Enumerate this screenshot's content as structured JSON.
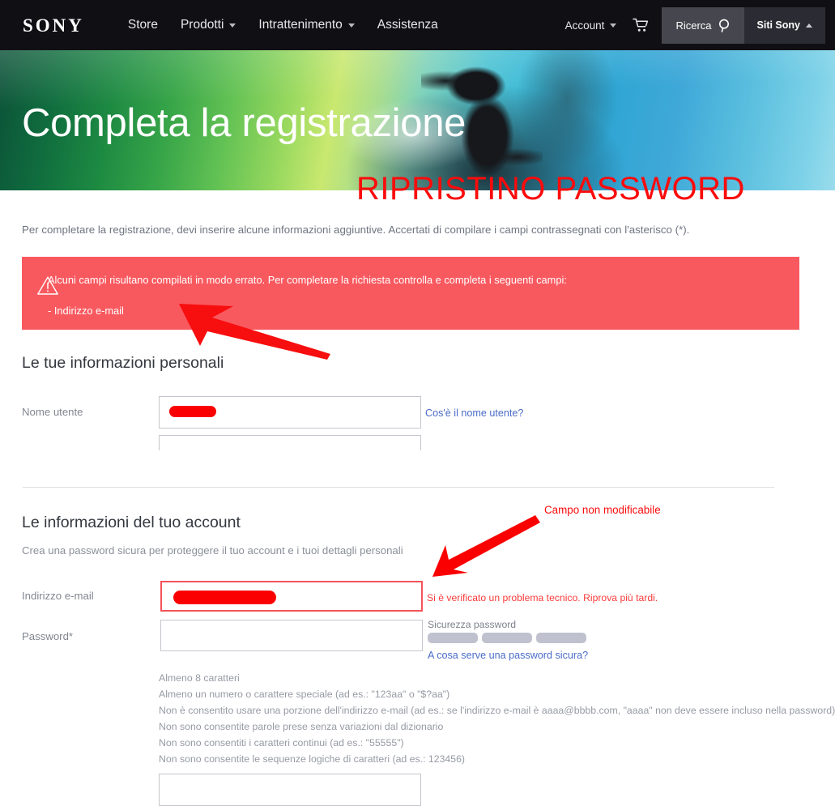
{
  "nav": {
    "logo": "SONY",
    "links": [
      {
        "label": "Store",
        "caret": null
      },
      {
        "label": "Prodotti",
        "caret": "chevron-down"
      },
      {
        "label": "Intrattenimento",
        "caret": "chevron-down"
      },
      {
        "label": "Assistenza",
        "caret": null
      }
    ],
    "account_label": "Account",
    "cart_icon": "shopping-cart-icon",
    "search_button": "Ricerca",
    "search_icon": "search-icon",
    "sites_button": "Siti Sony",
    "sites_caret": "chevron-up"
  },
  "hero": {
    "title": "Completa la registrazione"
  },
  "annotations": {
    "headline": "RIPRISTINO PASSWORD",
    "field_note": "Campo non modificabile"
  },
  "page": {
    "intro": "Per completare la registrazione, devi inserire alcune informazioni aggiuntive. Accertati di compilare i campi contrassegnati con l'asterisco (*)."
  },
  "error_banner": {
    "icon": "warning-triangle-icon",
    "message": "Alcuni campi risultano compilati in modo errato. Per completare la richiesta controlla e completa i seguenti campi:",
    "items": [
      "- Indirizzo e-mail"
    ],
    "color": "#f8595f"
  },
  "personal_section": {
    "title": "Le tue informazioni personali",
    "username": {
      "label": "Nome utente",
      "value": "",
      "placeholder": "",
      "help_link": "Cos'è il nome utente?"
    }
  },
  "account_section": {
    "title": "Le informazioni del tuo account",
    "subtitle": "Crea una password sicura per proteggere il tuo account e i tuoi dettagli personali",
    "email": {
      "label": "Indirizzo e-mail",
      "value": "",
      "error": "Si è verificato un problema tecnico. Riprova più tardi."
    },
    "password": {
      "label": "Password*",
      "value": "",
      "strength_label": "Sicurezza password",
      "strength_segments": 3,
      "strength_filled": 0,
      "help_link": "A cosa serve una password sicura?"
    },
    "password_rules": [
      "Almeno 8 caratteri",
      "Almeno un numero o carattere speciale (ad es.: \"123aa\" o \"$?aa\")",
      "Non è consentito usare una porzione dell'indirizzo e-mail (ad es.: se l'indirizzo e-mail è aaaa@bbbb.com, \"aaaa\" non deve essere incluso nella password)",
      "Non sono consentite parole prese senza variazioni dal dizionario",
      "Non sono consentiti i caratteri continui (ad es.: \"55555\")",
      "Non sono consentite le sequenze logiche di caratteri (ad es.: 123456)"
    ]
  },
  "colors": {
    "nav_bg": "#101014",
    "error_red": "#f8595f",
    "annotation_red": "#fb0b0b",
    "link_blue": "#4a6cc8"
  }
}
